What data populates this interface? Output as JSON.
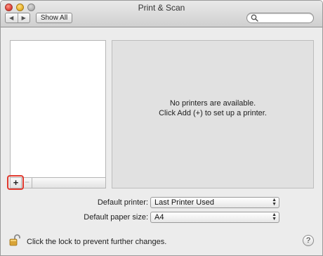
{
  "window": {
    "title": "Print & Scan"
  },
  "toolbar": {
    "back_glyph": "◀",
    "forward_glyph": "▶",
    "show_all_label": "Show All",
    "search_placeholder": ""
  },
  "printer_list": {
    "items": [],
    "add_label": "+",
    "remove_label": "−"
  },
  "detail": {
    "message_line1": "No printers are available.",
    "message_line2": "Click Add (+) to set up a printer."
  },
  "defaults": {
    "printer_label": "Default printer:",
    "printer_value": "Last Printer Used",
    "paper_label": "Default paper size:",
    "paper_value": "A4"
  },
  "footer": {
    "lock_message": "Click the lock to prevent further changes.",
    "help_label": "?"
  },
  "colors": {
    "highlight": "#e03a2f",
    "window_bg": "#ececec",
    "detail_bg": "#e1e1e1"
  }
}
